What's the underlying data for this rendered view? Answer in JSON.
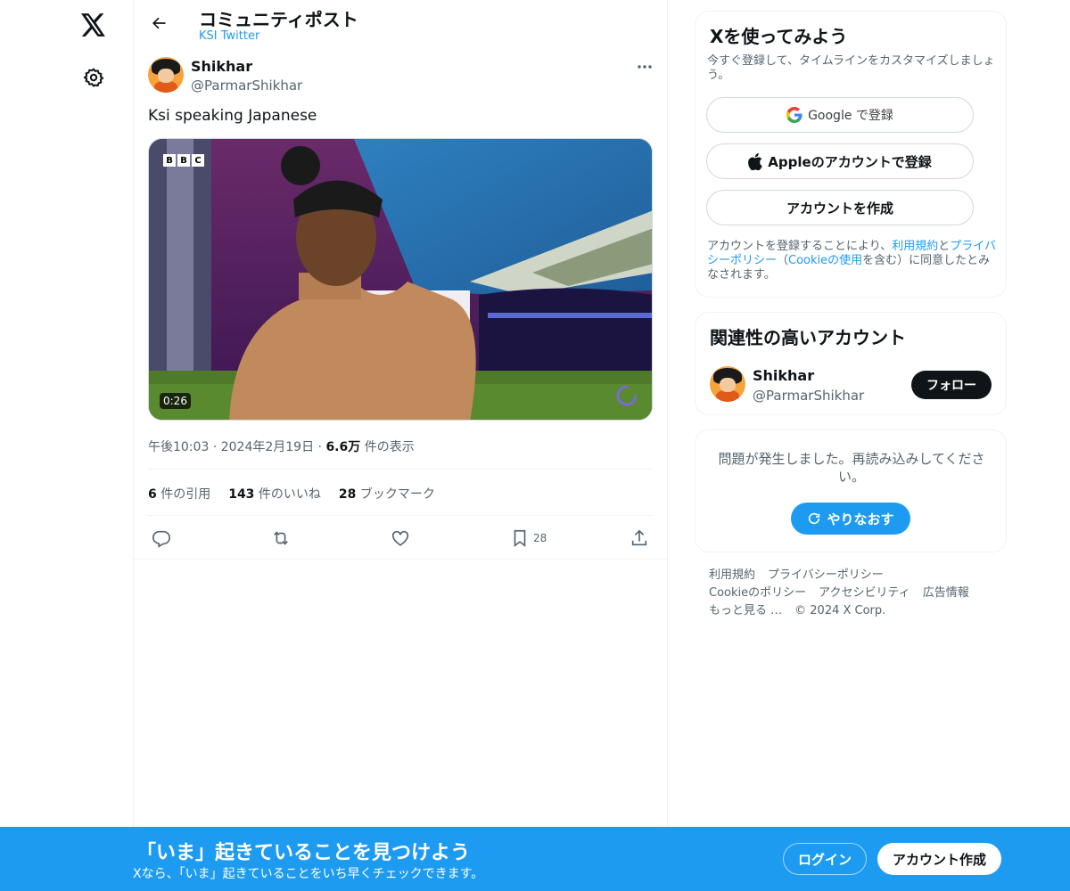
{
  "header": {
    "title": "コミュニティポスト",
    "subtitle": "KSI Twitter"
  },
  "tweet": {
    "author_name": "Shikhar",
    "author_handle": "@ParmarShikhar",
    "text": "Ksi speaking Japanese",
    "media": {
      "duration": "0:26",
      "watermark": [
        "B",
        "B",
        "C"
      ]
    },
    "time": "午後10:03",
    "date": "2024年2月19日",
    "views_value": "6.6万",
    "views_label": "件の表示",
    "quotes_value": "6",
    "quotes_label": "件の引用",
    "likes_value": "143",
    "likes_label": "件のいいね",
    "bookmarks_value": "28",
    "bookmarks_label": "ブックマーク",
    "bookmark_count": "28"
  },
  "signup": {
    "title": "Xを使ってみよう",
    "description": "今すぐ登録して、タイムラインをカスタマイズしましょう。",
    "google_label": "Google で登録",
    "apple_label": "Appleのアカウントで登録",
    "create_label": "アカウントを作成",
    "legal_prefix": "アカウントを登録することにより、",
    "legal_terms": "利用規約",
    "legal_and": "と",
    "legal_privacy": "プライバシーポリシー",
    "legal_open": "（",
    "legal_cookie": "Cookieの使用",
    "legal_suffix": "を含む）に同意したとみなされます。"
  },
  "related": {
    "title": "関連性の高いアカウント",
    "name": "Shikhar",
    "handle": "@ParmarShikhar",
    "follow_label": "フォロー"
  },
  "error": {
    "message": "問題が発生しました。再読み込みしてください。",
    "retry_label": "やりなおす"
  },
  "footer": {
    "terms": "利用規約",
    "privacy": "プライバシーポリシー",
    "cookie": "Cookieのポリシー",
    "accessibility": "アクセシビリティ",
    "ads": "広告情報",
    "more": "もっと見る …",
    "copyright": "© 2024 X Corp."
  },
  "banner": {
    "title": "「いま」起きていることを見つけよう",
    "subtitle": "Xなら、「いま」起きていることをいち早くチェックできます。",
    "login_label": "ログイン",
    "create_label": "アカウント作成"
  },
  "colors": {
    "accent": "#1d9bf0",
    "text": "#0f1419",
    "secondary": "#536471",
    "border": "#eff3f4"
  },
  "icons": [
    "x-logo-icon",
    "gear-icon",
    "back-arrow-icon",
    "more-icon",
    "reply-icon",
    "retweet-icon",
    "like-icon",
    "bookmark-icon",
    "share-icon",
    "google-icon",
    "apple-icon",
    "refresh-icon"
  ]
}
